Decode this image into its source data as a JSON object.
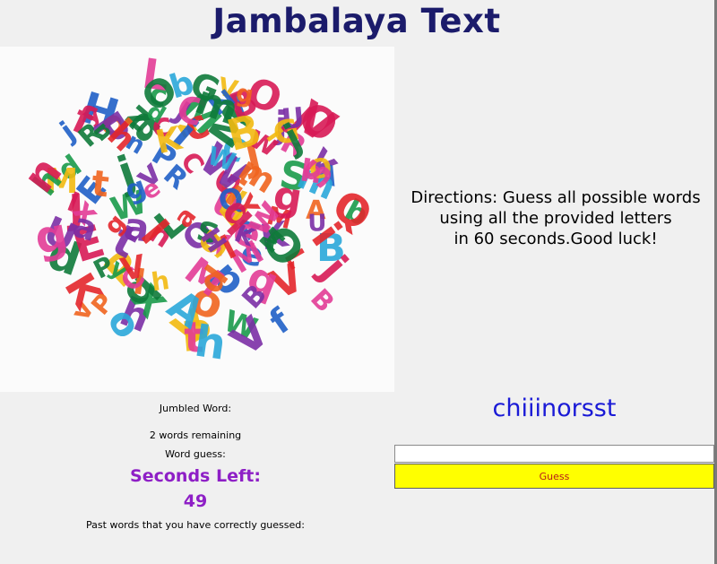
{
  "page": {
    "title": "Jambalaya Text"
  },
  "directions": {
    "lines": [
      "Directions: Guess all possible words",
      "using all the provided letters",
      "in 60 seconds.Good luck!"
    ]
  },
  "game": {
    "jumbled_word_label": "Jumbled Word:",
    "words_remaining": "2 words remaining",
    "word_guess_label": "Word guess:",
    "seconds_left_label": "Seconds Left:",
    "seconds_left_value": "49",
    "past_words_label": "Past words that you have correctly guessed:",
    "scrambled_letters": "chiiinorsst",
    "guess_input_value": "",
    "guess_button_label": "Guess"
  },
  "image": {
    "subject": "colorful-alphabet-letters-pile"
  },
  "colors": {
    "title": "#1b1b6b",
    "timer": "#8e1fc6",
    "scramble": "#1a1ad6",
    "button_bg": "#ffff00",
    "button_text": "#b51a1a"
  }
}
